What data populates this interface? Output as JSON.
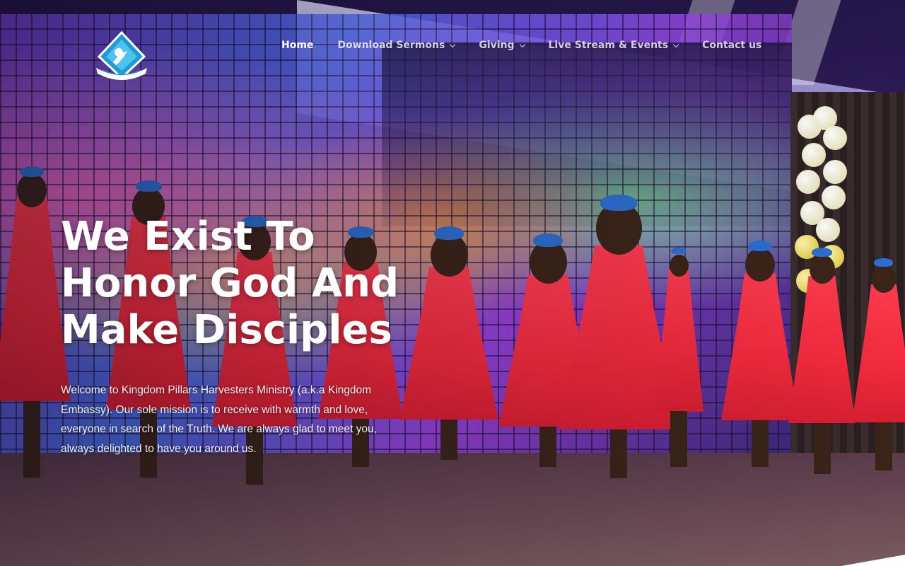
{
  "header": {
    "logo_icon": "church-logo-icon",
    "nav": [
      {
        "label": "Home",
        "active": true,
        "has_dropdown": false
      },
      {
        "label": "Download Sermons",
        "active": false,
        "has_dropdown": true
      },
      {
        "label": "Giving",
        "active": false,
        "has_dropdown": true
      },
      {
        "label": "Live Stream & Events",
        "active": false,
        "has_dropdown": true
      },
      {
        "label": "Contact us",
        "active": false,
        "has_dropdown": false
      }
    ]
  },
  "hero": {
    "headline": "We Exist To Honor God And Make Disciples",
    "intro": "Welcome to Kingdom Pillars Harvesters Ministry (a.k.a Kingdom Embassy). Our sole mission is to receive with warmth and love, everyone in search of the Truth. We are always glad to meet you, always delighted to have you around us."
  },
  "colors": {
    "text": "#ffffff",
    "dress": "#f02a3c",
    "logo_blue": "#1e9ad6"
  }
}
